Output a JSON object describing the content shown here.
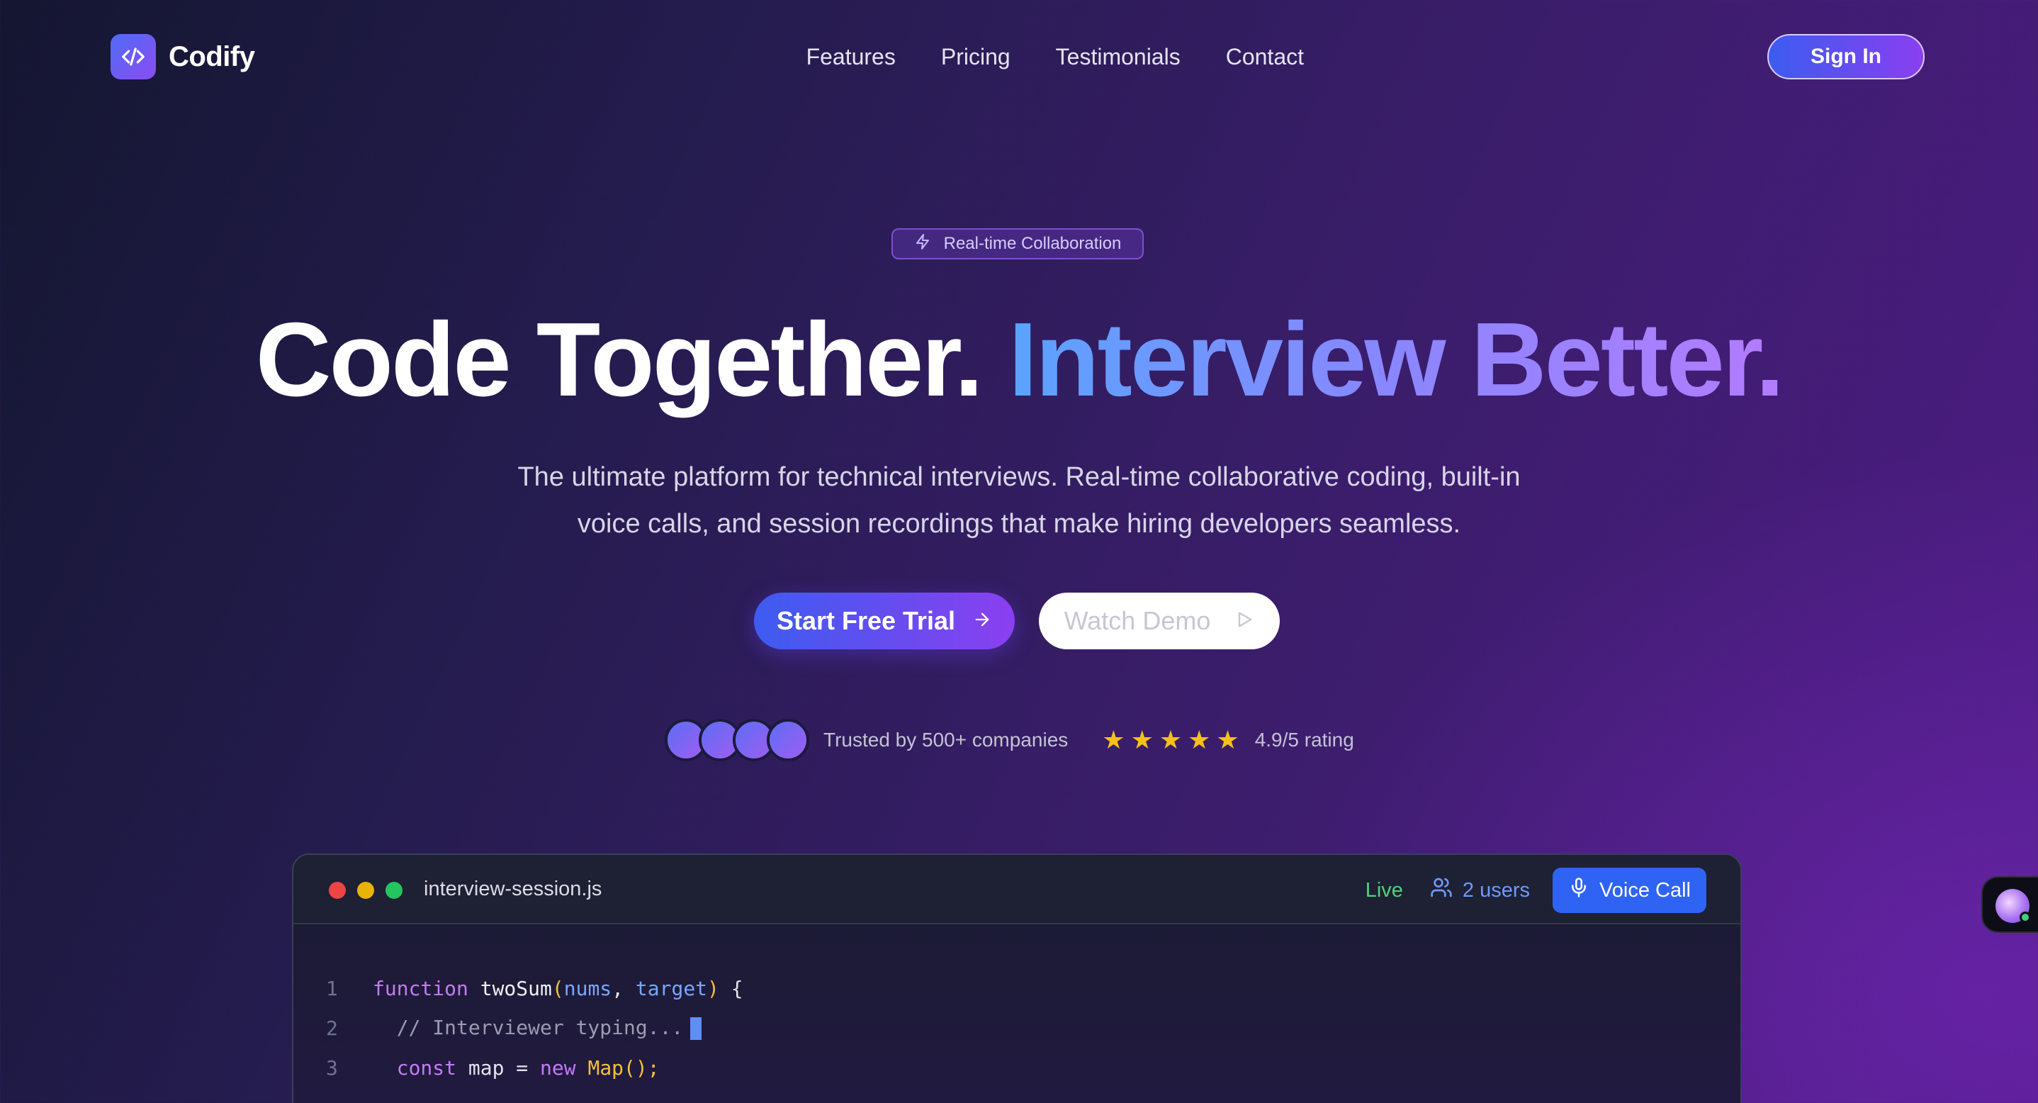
{
  "brand": {
    "name": "Codify",
    "icon": "code-brackets-icon"
  },
  "nav": {
    "links": [
      "Features",
      "Pricing",
      "Testimonials",
      "Contact"
    ],
    "sign_in": "Sign In"
  },
  "hero": {
    "badge": "Real-time Collaboration",
    "title_plain": "Code Together.",
    "title_accent": "Interview Better.",
    "subtitle_line1": "The ultimate platform for technical interviews. Real-time collaborative coding, built-in",
    "subtitle_line2": "voice calls, and session recordings that make hiring developers seamless.",
    "cta_primary": "Start Free Trial",
    "cta_secondary": "Watch Demo"
  },
  "trust": {
    "companies_text": "Trusted by 500+ companies",
    "rating_stars": 5,
    "rating_text": "4.9/5 rating"
  },
  "editor": {
    "filename": "interview-session.js",
    "status": "Live",
    "users": "2 users",
    "voice_call": "Voice Call",
    "lines": [
      {
        "no": "1",
        "text": "function twoSum(nums, target) {"
      },
      {
        "no": "2",
        "text": "  // Interviewer typing..."
      },
      {
        "no": "3",
        "text": "  const map = new Map();"
      }
    ]
  },
  "colors": {
    "accent_blue": "#3d5cf0",
    "accent_purple": "#8b3ff0",
    "live_green": "#4fd27a",
    "star_yellow": "#f5c01a"
  }
}
